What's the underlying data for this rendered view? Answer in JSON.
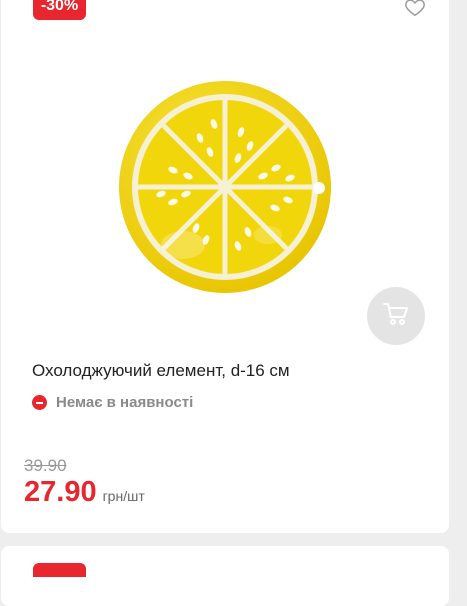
{
  "product": {
    "discount_badge": "-30%",
    "title": "Охолоджуючий елемент, d-16 см",
    "stock_status": "Немає в наявності",
    "old_price": "39.90",
    "price": "27.90",
    "price_unit": "грн/шт"
  },
  "icons": {
    "wishlist": "heart-icon",
    "cart": "cart-icon",
    "stock": "minus-circle-icon"
  },
  "colors": {
    "accent": "#e8262e",
    "lemon": "#f2d60c"
  }
}
